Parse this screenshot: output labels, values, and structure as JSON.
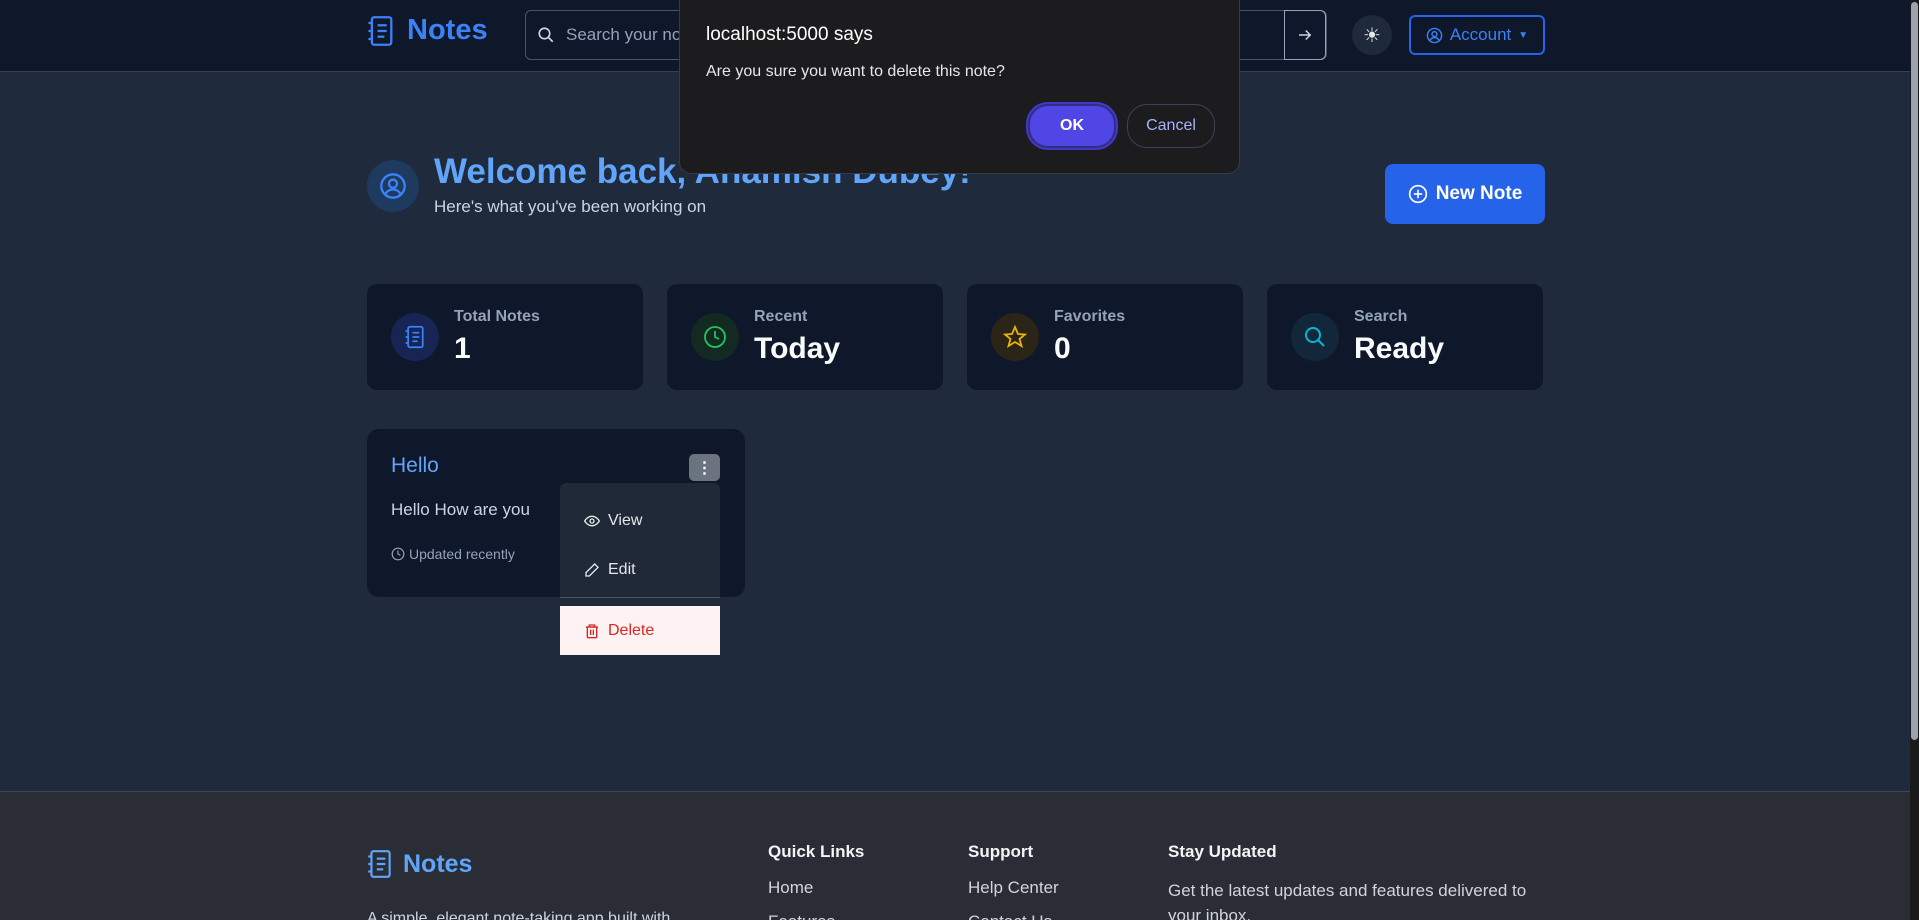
{
  "header": {
    "brand": "Notes",
    "search_placeholder": "Search your notes...",
    "search_submit_icon": "arrow-right-icon",
    "theme_icon": "sun-icon",
    "account_label": "Account"
  },
  "welcome": {
    "title": "Welcome back, Anamish Dubey!",
    "subtitle": "Here's what you've been working on",
    "new_note_label": "New Note"
  },
  "stats": [
    {
      "label": "Total Notes",
      "value": "1",
      "icon": "notebook-icon",
      "color": "#3b82f6"
    },
    {
      "label": "Recent",
      "value": "Today",
      "icon": "clock-icon",
      "color": "#22c55e"
    },
    {
      "label": "Favorites",
      "value": "0",
      "icon": "star-icon",
      "color": "#eab308"
    },
    {
      "label": "Search",
      "value": "Ready",
      "icon": "search-icon",
      "color": "#06b6d4"
    }
  ],
  "note": {
    "title": "Hello",
    "body": "Hello How are you",
    "meta": "Updated recently"
  },
  "menu": {
    "view": "View",
    "edit": "Edit",
    "delete": "Delete"
  },
  "dialog": {
    "title": "localhost:5000 says",
    "message": "Are you sure you want to delete this note?",
    "ok": "OK",
    "cancel": "Cancel"
  },
  "footer": {
    "brand": "Notes",
    "description": "A simple, elegant note-taking app built with",
    "quick_links": {
      "heading": "Quick Links",
      "items": [
        "Home",
        "Features"
      ]
    },
    "support": {
      "heading": "Support",
      "items": [
        "Help Center",
        "Contact Us"
      ]
    },
    "stay_updated": {
      "heading": "Stay Updated",
      "text": "Get the latest updates and features delivered to your inbox."
    }
  },
  "colors": {
    "accent": "#2563eb",
    "danger": "#dc2626",
    "dialog_primary": "#4f46e5"
  }
}
